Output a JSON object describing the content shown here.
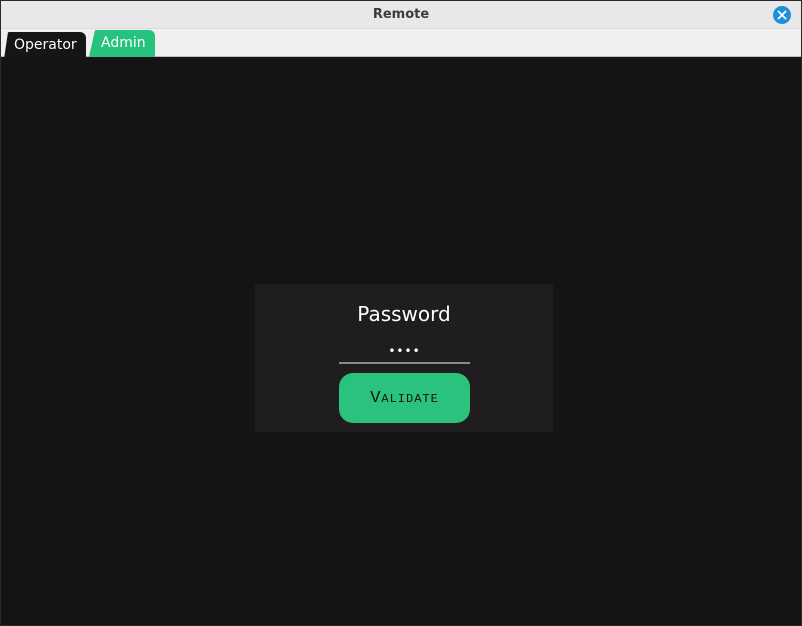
{
  "window": {
    "title": "Remote"
  },
  "tabs": [
    {
      "label": "Operator",
      "selected": false
    },
    {
      "label": "Admin",
      "selected": true
    }
  ],
  "login": {
    "title": "Password",
    "password_value": "••••",
    "validate_label": "Validate"
  },
  "colors": {
    "accent": "#2bc27d",
    "background": "#141414",
    "panel": "#1f1d1e",
    "close_button": "#1f8fdc"
  },
  "icons": {
    "close": "close-icon"
  }
}
